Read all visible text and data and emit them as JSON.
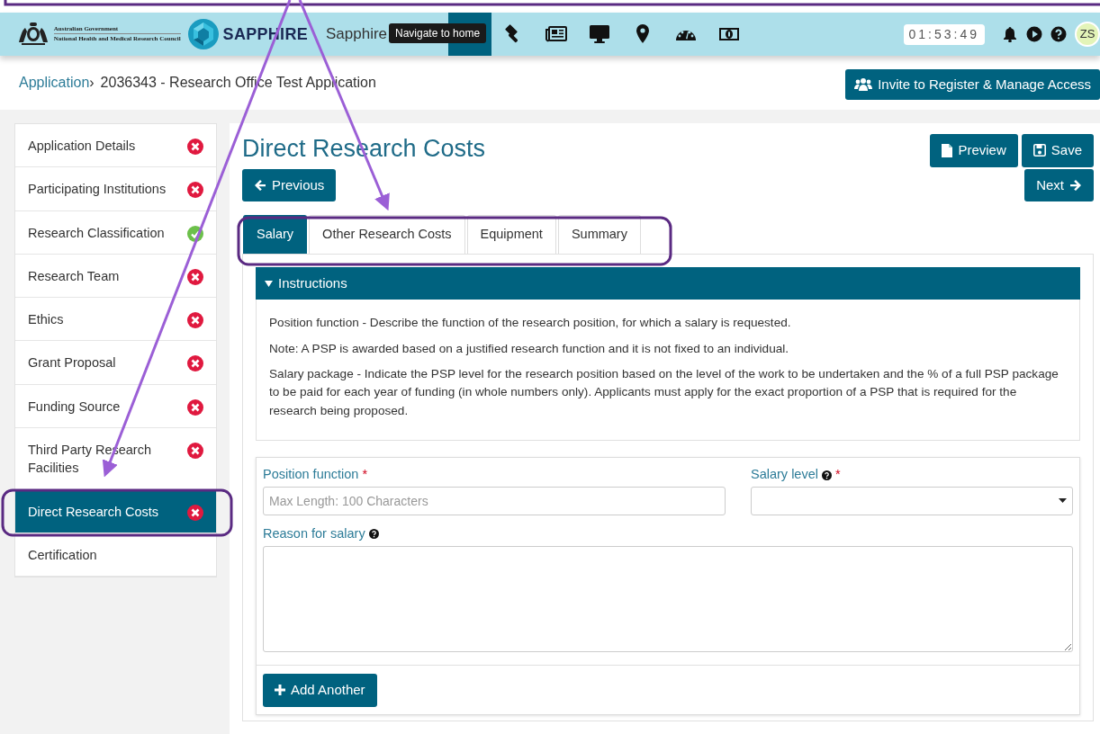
{
  "header": {
    "org_lines": [
      "Australian Government",
      "National Health and Medical Research Council"
    ],
    "brand": "SAPPHIRE",
    "app_name": "Sapphire",
    "tooltip": "Navigate to home",
    "nav_icons": [
      {
        "kind": "home",
        "selected": true
      },
      {
        "kind": "gavel",
        "selected": false
      },
      {
        "kind": "newspaper",
        "selected": false
      },
      {
        "kind": "monitor",
        "selected": false
      },
      {
        "kind": "pin",
        "selected": false
      },
      {
        "kind": "dashboard",
        "selected": false
      },
      {
        "kind": "money",
        "selected": false
      }
    ],
    "timer": "01:53:49",
    "avatar": "ZS"
  },
  "breadcrumb": {
    "parent": "Application",
    "separator": "›",
    "current": "2036343 - Research Office Test Application"
  },
  "invite_button": "Invite to Register & Manage Access",
  "sidebar": {
    "items": [
      {
        "label": "Application Details",
        "kind": "error",
        "selected": false
      },
      {
        "label": "Participating Institutions",
        "kind": "error",
        "selected": false
      },
      {
        "label": "Research Classification",
        "kind": "complete",
        "selected": false
      },
      {
        "label": "Research Team",
        "kind": "error",
        "selected": false
      },
      {
        "label": "Ethics",
        "kind": "error",
        "selected": false
      },
      {
        "label": "Grant Proposal",
        "kind": "error",
        "selected": false
      },
      {
        "label": "Funding Source",
        "kind": "error",
        "selected": false
      },
      {
        "label": "Third Party Research Facilities",
        "kind": "error",
        "selected": false
      },
      {
        "label": "Direct Research Costs",
        "kind": "error",
        "selected": true
      },
      {
        "label": "Certification",
        "kind": "plain",
        "selected": false
      }
    ]
  },
  "page_title": "Direct Research Costs",
  "actions": [
    {
      "kind": "preview",
      "label": "Preview"
    },
    {
      "kind": "save",
      "label": "Save"
    }
  ],
  "previous": "Previous",
  "next": "Next",
  "tabs": [
    {
      "label": "Salary",
      "selected": true
    },
    {
      "label": "Other Research Costs",
      "selected": false
    },
    {
      "label": "Equipment",
      "selected": false
    },
    {
      "label": "Summary",
      "selected": false
    }
  ],
  "instructions": {
    "title": "Instructions",
    "expanded": true,
    "paragraphs": [
      "Position function - Describe the function of the research position, for which a salary is requested.",
      "Note: A PSP is awarded based on a justified research function and it is not fixed to an individual.",
      "Salary package - Indicate the PSP level for the research position based on the level of the work to be undertaken and the % of a full PSP package to be paid for each year of funding (in whole numbers only). Applicants must apply for the exact proportion of a PSP that is required for the research being proposed."
    ]
  },
  "form": {
    "required_mark": "*",
    "fields": [
      {
        "kind": "text",
        "label": "Position function",
        "required": true,
        "help": false,
        "placeholder": "Max Length: 100 Characters"
      },
      {
        "kind": "select",
        "label": "Salary level",
        "required": true,
        "help": true
      },
      {
        "kind": "textarea",
        "label": "Reason for salary",
        "required": false,
        "help": true
      }
    ],
    "add_button": "Add Another"
  },
  "annotations": [
    {
      "kind": "frame"
    },
    {
      "kind": "arrow"
    },
    {
      "kind": "arrow"
    },
    {
      "kind": "highlight"
    },
    {
      "kind": "highlight"
    }
  ]
}
